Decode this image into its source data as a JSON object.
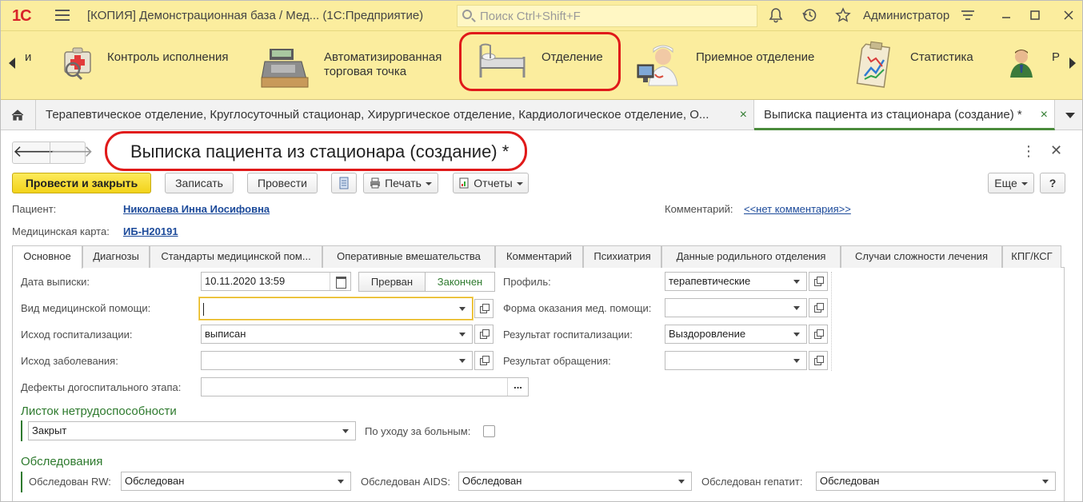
{
  "window": {
    "logo": "1С",
    "title": "[КОПИЯ] Демонстрационная база / Мед...   (1С:Предприятие)",
    "search_placeholder": "Поиск Ctrl+Shift+F",
    "user": "Администратор",
    "icons": [
      "bell-icon",
      "history-icon",
      "star-icon",
      "settings-icon",
      "minimize-icon",
      "maximize-icon",
      "close-icon"
    ]
  },
  "sections": {
    "partial_left": "и",
    "partial_right": "Р",
    "items": [
      {
        "label": "Контроль исполнения",
        "icon": "control-icon"
      },
      {
        "label": "Автоматизированная\nторговая точка",
        "icon": "cash-register-icon"
      },
      {
        "label": "Отделение",
        "icon": "hospital-bed-icon"
      },
      {
        "label": "Приемное отделение",
        "icon": "doctor-icon"
      },
      {
        "label": "Статистика",
        "icon": "statistics-icon"
      }
    ]
  },
  "open_tabs": [
    {
      "label": "Терапевтическое отделение, Круглосуточный стационар, Хирургическое отделение, Кардиологическое отделение, О...",
      "close": "×"
    },
    {
      "label": "Выписка пациента из стационара (создание) *",
      "close": "×"
    }
  ],
  "form": {
    "nav_back": "🡐",
    "nav_forward": "🡒",
    "title": "Выписка пациента из стационара (создание) *",
    "menu": "⋮",
    "close": "✕",
    "commands": {
      "post_close": "Провести и закрыть",
      "save": "Записать",
      "post": "Провести",
      "print": "Печать",
      "reports": "Отчеты",
      "more": "Еще",
      "help": "?"
    },
    "patient_label": "Пациент:",
    "patient_value": "Николаева Инна Иосифовна",
    "card_label": "Медицинская карта:",
    "card_value": "ИБ-Н20191",
    "comment_label": "Комментарий:",
    "comment_value": "<<нет комментария>>"
  },
  "tabs": [
    "Основное",
    "Диагнозы",
    "Стандарты медицинской пом...",
    "Оперативные вмешательства",
    "Комментарий",
    "Психиатрия",
    "Данные родильного отделения",
    "Случаи сложности лечения",
    "КПГ/КСГ"
  ],
  "main": {
    "discharge_date_label": "Дата выписки:",
    "discharge_date_value": "10.11.2020 13:59",
    "interrupted": "Прерван",
    "finished": "Закончен",
    "care_type_label": "Вид медицинской помощи:",
    "care_type_value": "",
    "hosp_outcome_label": "Исход госпитализации:",
    "hosp_outcome_value": "выписан",
    "disease_outcome_label": "Исход заболевания:",
    "disease_outcome_value": "",
    "defects_label": "Дефекты догоспитального этапа:",
    "defects_value": "",
    "defects_button": "...",
    "profile_label": "Профиль:",
    "profile_value": "терапевтические",
    "care_form_label": "Форма оказания мед. помощи:",
    "care_form_value": "",
    "hosp_result_label": "Результат госпитализации:",
    "hosp_result_value": "Выздоровление",
    "appeal_result_label": "Результат обращения:",
    "appeal_result_value": ""
  },
  "sick_leave": {
    "title": "Листок нетрудоспособности",
    "status_value": "Закрыт",
    "care_label": "По уходу за больным:",
    "care_checked": false
  },
  "exams": {
    "title": "Обследования",
    "rw_label": "Обследован RW:",
    "rw_value": "Обследован",
    "aids_label": "Обследован AIDS:",
    "aids_value": "Обследован",
    "hep_label": "Обследован гепатит:",
    "hep_value": "Обследован"
  }
}
